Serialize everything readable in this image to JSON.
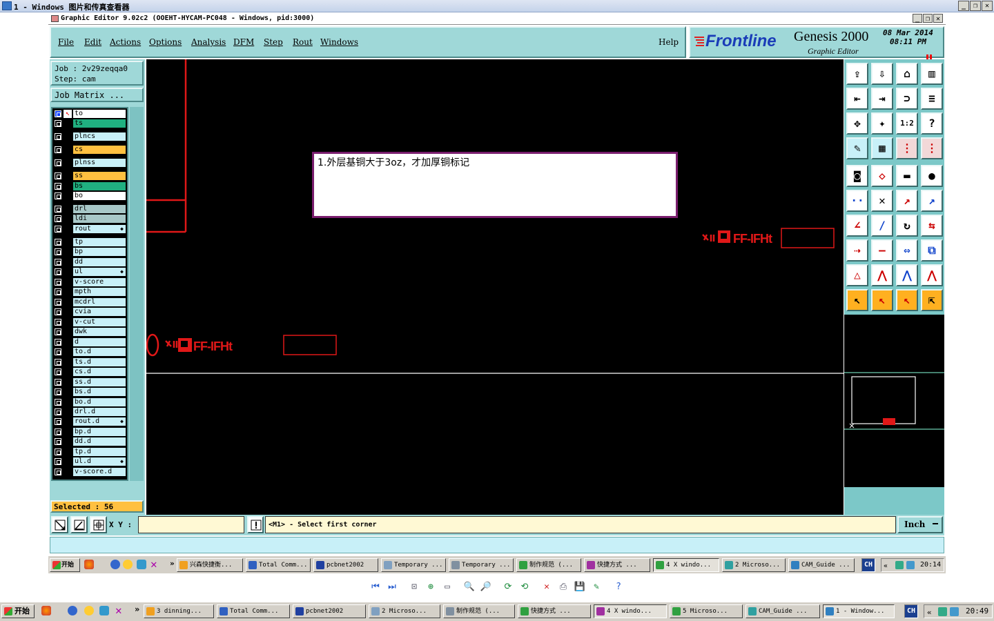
{
  "outer_window": {
    "title": "1 - Windows 图片和传真查看器"
  },
  "app": {
    "title": "Graphic Editor 9.02c2  (OOEHT-HYCAM-PC048 - Windows, pid:3000)",
    "menu": [
      "File",
      "Edit",
      "Actions",
      "Options",
      "Analysis",
      "DFM",
      "Step",
      "Rout",
      "Windows"
    ],
    "help": "Help",
    "brand": {
      "logo": "Frontline",
      "product": "Genesis 2000",
      "subtitle": "Graphic Editor",
      "date": "08 Mar 2014",
      "time": "08:11 PM"
    }
  },
  "job": {
    "job_label": "Job : 2v29zeqqa0",
    "step_label": "Step: cam",
    "matrix_button": "Job Matrix ..."
  },
  "layers": [
    {
      "name": "to",
      "color": "#ffffff"
    },
    {
      "name": "ts",
      "color": "#20b080"
    },
    {
      "name": "plncs",
      "color": "#c8f0f8"
    },
    {
      "name": "cs",
      "color": "#ffc040"
    },
    {
      "name": "plnss",
      "color": "#c8f0f8"
    },
    {
      "name": "ss",
      "color": "#ffc040"
    },
    {
      "name": "bs",
      "color": "#20b080"
    },
    {
      "name": "bo",
      "color": "#ffffff"
    },
    {
      "name": "drl",
      "color": "#a8c8c8"
    },
    {
      "name": "ldi",
      "color": "#a8c8c8"
    },
    {
      "name": "rout",
      "color": "#c8f0f8"
    },
    {
      "name": "tp",
      "color": "#c8f0f8"
    },
    {
      "name": "bp",
      "color": "#c8f0f8"
    },
    {
      "name": "dd",
      "color": "#c8f0f8"
    },
    {
      "name": "ul",
      "color": "#c8f0f8"
    },
    {
      "name": "v-score",
      "color": "#c8f0f8"
    },
    {
      "name": "mpth",
      "color": "#c8f0f8"
    },
    {
      "name": "mcdrl",
      "color": "#c8f0f8"
    },
    {
      "name": "cvia",
      "color": "#c8f0f8"
    },
    {
      "name": "v-cut",
      "color": "#c8f0f8"
    },
    {
      "name": "dwk",
      "color": "#c8f0f8"
    },
    {
      "name": "d",
      "color": "#c8f0f8"
    },
    {
      "name": "to.d",
      "color": "#c8f0f8"
    },
    {
      "name": "ts.d",
      "color": "#c8f0f8"
    },
    {
      "name": "cs.d",
      "color": "#c8f0f8"
    },
    {
      "name": "ss.d",
      "color": "#c8f0f8"
    },
    {
      "name": "bs.d",
      "color": "#c8f0f8"
    },
    {
      "name": "bo.d",
      "color": "#c8f0f8"
    },
    {
      "name": "drl.d",
      "color": "#c8f0f8"
    },
    {
      "name": "rout.d",
      "color": "#c8f0f8"
    },
    {
      "name": "bp.d",
      "color": "#c8f0f8"
    },
    {
      "name": "dd.d",
      "color": "#c8f0f8"
    },
    {
      "name": "tp.d",
      "color": "#c8f0f8"
    },
    {
      "name": "ul.d",
      "color": "#c8f0f8"
    },
    {
      "name": "v-score.d",
      "color": "#c8f0f8"
    }
  ],
  "selected": "Selected : 56",
  "annotation_text": "1.外层基铜大于3oz，才加厚铜标记",
  "status": {
    "xy_label": "X Y :",
    "xy_value": "",
    "prompt": "<M1> - Select first corner",
    "units": "Inch"
  },
  "inner_taskbar": {
    "start": "开始",
    "tasks": [
      "兴森快捷衡...",
      "Total Comm...",
      "pcbnet2002",
      "Temporary ...",
      "Temporary ...",
      "制作规范 (...",
      "快捷方式 ...",
      "4 X windo...",
      "2 Microso...",
      "CAM_Guide ..."
    ],
    "lang": "CH",
    "clock": "20:14"
  },
  "outer_taskbar": {
    "start": "开始",
    "tasks": [
      "3 dinning...",
      "Total Comm...",
      "pcbnet2002",
      "2 Microso...",
      "制作规范 (...",
      "快捷方式 ...",
      "4 X windo...",
      "5 Microso...",
      "CAM_Guide ...",
      "1 - Window..."
    ],
    "lang": "CH",
    "clock": "20:49"
  },
  "viewer_toolbar": [
    "prev-icon",
    "next-icon",
    "best-fit-icon",
    "actual-size-icon",
    "slideshow-icon",
    "zoom-in-icon",
    "zoom-out-icon",
    "rotate-cw-icon",
    "rotate-ccw-icon",
    "delete-icon",
    "print-icon",
    "save-icon",
    "edit-icon",
    "help-icon"
  ],
  "tools": [
    "open-icon",
    "save-icon",
    "home-icon",
    "window-icon",
    "prev-step-icon",
    "next-step-icon",
    "zoom-reset-icon",
    "snap-icon",
    "fit-icon",
    "zoom-in-icon",
    "scale-icon",
    "help-icon",
    "measure-icon",
    "grid-icon",
    "layers-icon",
    "layers2-icon",
    "camera-icon",
    "feature-icon",
    "ruler-icon",
    "pad-icon",
    "connect-icon",
    "cross-icon",
    "line-red-icon",
    "line-blue-icon",
    "angle-icon",
    "slash-icon",
    "arc-icon",
    "mirror-icon",
    "move-icon",
    "minus-icon",
    "stretch-icon",
    "copy-icon",
    "triangle-icon",
    "lift-icon",
    "anchor-icon",
    "poly-icon",
    "pointer-icon",
    "select-icon",
    "cursor-icon",
    "multi-select-icon"
  ]
}
